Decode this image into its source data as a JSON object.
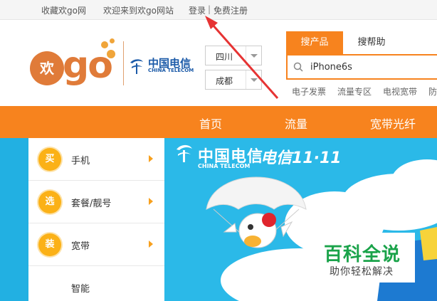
{
  "topbar": {
    "favorite": "收藏欢go网",
    "welcome": "欢迎来到欢go网站",
    "login": "登录",
    "separator": "|",
    "register": "免费注册"
  },
  "logo": {
    "bubble_text": "欢",
    "go_text": "go",
    "telecom_cn": "中国电信",
    "telecom_en": "CHINA TELECOM"
  },
  "region": {
    "province": "四川",
    "city": "成都"
  },
  "search": {
    "tabs": [
      "搜产品",
      "搜帮助"
    ],
    "active_tab": "搜产品",
    "value": "iPhone6s",
    "hot_links": [
      "电子发票",
      "流量专区",
      "电视宽带",
      "防"
    ]
  },
  "nav": {
    "items": [
      "首页",
      "流量",
      "宽带光纤"
    ]
  },
  "categories": [
    {
      "badge": "买",
      "label": "手机"
    },
    {
      "badge": "选",
      "label": "套餐/靓号"
    },
    {
      "badge": "装",
      "label": "宽带"
    },
    {
      "badge": "",
      "label": "智能"
    }
  ],
  "banner": {
    "brand_cn": "中国电信",
    "brand_en": "CHINA TELECOM",
    "event": "电信11·11"
  },
  "watermark": {
    "title": "百科全说",
    "subtitle": "助你轻松解决"
  },
  "colors": {
    "accent_orange": "#f7831e",
    "banner_blue": "#2bb9e8",
    "badge_yellow": "#fbb117",
    "telecom_blue": "#1b5aa8",
    "arrow_red": "#e63333",
    "watermark_green": "#1aa34a"
  }
}
